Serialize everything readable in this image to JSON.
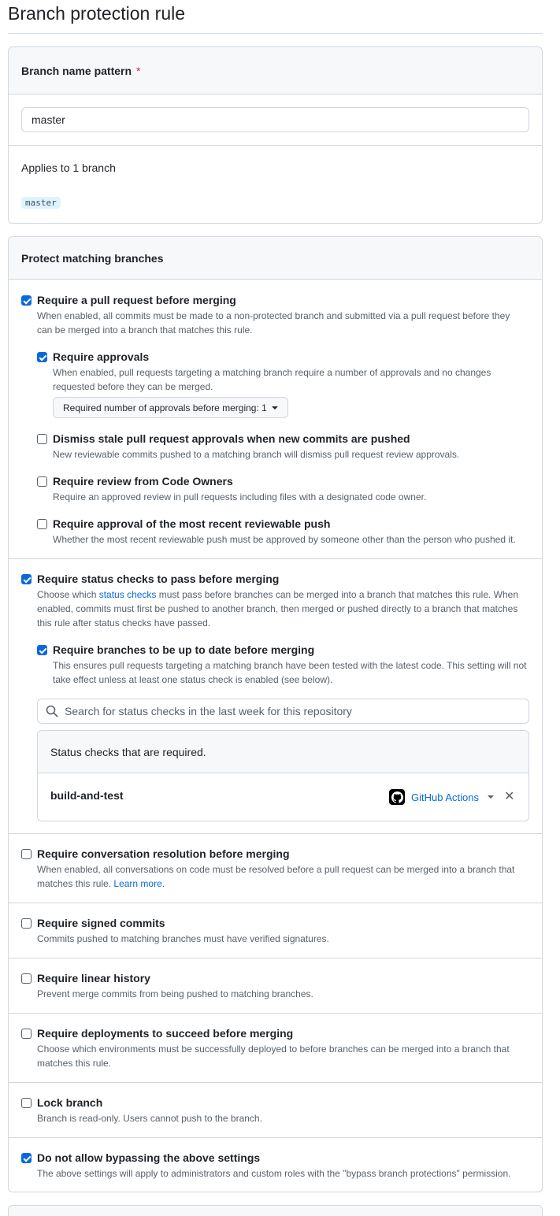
{
  "page": {
    "title": "Branch protection rule"
  },
  "pattern": {
    "header": "Branch name pattern",
    "required_mark": "*",
    "value": "master",
    "applies_label": "Applies to 1 branch",
    "matched_branch": "master"
  },
  "protect": {
    "header": "Protect matching branches",
    "pull_request": {
      "checked": true,
      "label": "Require a pull request before merging",
      "desc": "When enabled, all commits must be made to a non-protected branch and submitted via a pull request before they can be merged into a branch that matches this rule."
    },
    "approvals": {
      "checked": true,
      "label": "Require approvals",
      "desc": "When enabled, pull requests targeting a matching branch require a number of approvals and no changes requested before they can be merged.",
      "select_label": "Required number of approvals before merging: 1"
    },
    "dismiss_stale": {
      "checked": false,
      "label": "Dismiss stale pull request approvals when new commits are pushed",
      "desc": "New reviewable commits pushed to a matching branch will dismiss pull request review approvals."
    },
    "code_owners": {
      "checked": false,
      "label": "Require review from Code Owners",
      "desc": "Require an approved review in pull requests including files with a designated code owner."
    },
    "recent_push": {
      "checked": false,
      "label": "Require approval of the most recent reviewable push",
      "desc": "Whether the most recent reviewable push must be approved by someone other than the person who pushed it."
    },
    "status_checks": {
      "checked": true,
      "label": "Require status checks to pass before merging",
      "desc_pre": "Choose which ",
      "desc_link": "status checks",
      "desc_post": " must pass before branches can be merged into a branch that matches this rule. When enabled, commits must first be pushed to another branch, then merged or pushed directly to a branch that matches this rule after status checks have passed."
    },
    "up_to_date": {
      "checked": true,
      "label": "Require branches to be up to date before merging",
      "desc": "This ensures pull requests targeting a matching branch have been tested with the latest code. This setting will not take effect unless at least one status check is enabled (see below)."
    },
    "status_search": {
      "placeholder": "Search for status checks in the last week for this repository"
    },
    "required_checks": {
      "header": "Status checks that are required.",
      "items": [
        {
          "name": "build-and-test",
          "app": "GitHub Actions"
        }
      ]
    },
    "conversation": {
      "checked": false,
      "label": "Require conversation resolution before merging",
      "desc": "When enabled, all conversations on code must be resolved before a pull request can be merged into a branch that matches this rule.",
      "link": "Learn more."
    },
    "signed": {
      "checked": false,
      "label": "Require signed commits",
      "desc": "Commits pushed to matching branches must have verified signatures."
    },
    "linear": {
      "checked": false,
      "label": "Require linear history",
      "desc": "Prevent merge commits from being pushed to matching branches."
    },
    "deployments": {
      "checked": false,
      "label": "Require deployments to succeed before merging",
      "desc": "Choose which environments must be successfully deployed to before branches can be merged into a branch that matches this rule."
    },
    "lock": {
      "checked": false,
      "label": "Lock branch",
      "desc": "Branch is read-only. Users cannot push to the branch."
    },
    "no_bypass": {
      "checked": true,
      "label": "Do not allow bypassing the above settings",
      "desc": "The above settings will apply to administrators and custom roles with the \"bypass branch protections\" permission."
    }
  }
}
